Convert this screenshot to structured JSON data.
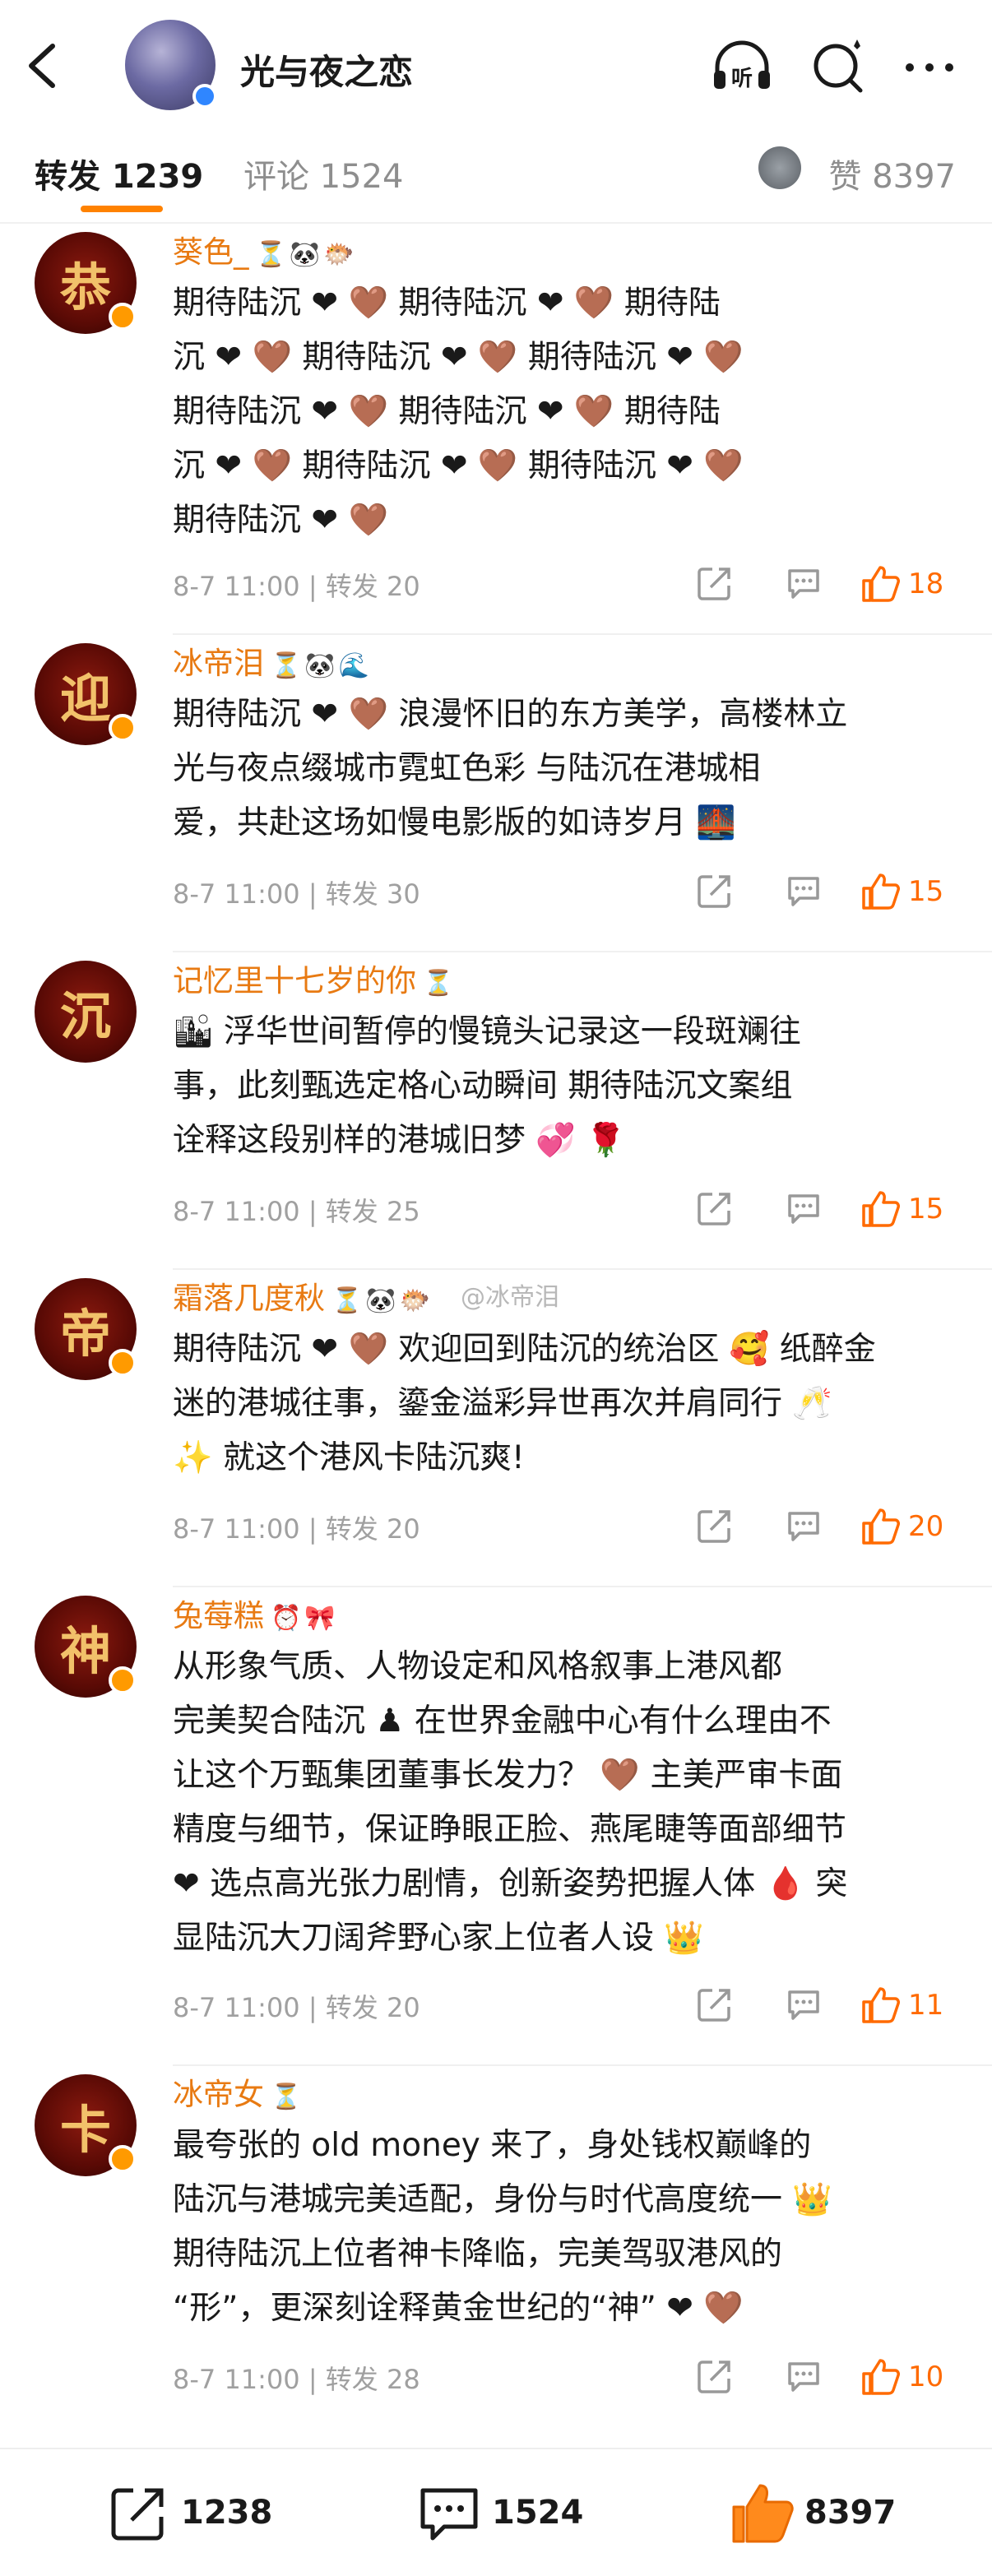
{
  "header": {
    "title": "光与夜之恋",
    "back_icon": "chevron-left-icon",
    "listen_label": "听",
    "colors": {
      "accent": "#ff8200",
      "name": "#e87a12",
      "like": "#ff6a00",
      "verified": "#2f86ff"
    }
  },
  "tabs": {
    "repost": "转发 1239",
    "comment": "评论 1524",
    "like": "赞 8397"
  },
  "watermark": "@冰帝泪",
  "comments": [
    {
      "avatar_glyph": "恭",
      "name": "葵色_",
      "name_emojis": "⏳🐼🐡",
      "lines": [
        "期待陆沉 ❤ 🤎  期待陆沉 ❤ 🤎  期待陆",
        "沉 ❤ 🤎  期待陆沉 ❤ 🤎  期待陆沉 ❤ 🤎",
        "期待陆沉 ❤ 🤎  期待陆沉 ❤ 🤎  期待陆",
        "沉 ❤ 🤎  期待陆沉 ❤ 🤎  期待陆沉 ❤ 🤎",
        "期待陆沉 ❤ 🤎"
      ],
      "meta": "8-7 11:00 | 转发 20",
      "likes": "18"
    },
    {
      "avatar_glyph": "迎",
      "name": "冰帝泪",
      "name_emojis": "⏳🐼🌊",
      "lines": [
        "期待陆沉 ❤ 🤎 浪漫怀旧的东方美学，高楼林立",
        "光与夜点缀城市霓虹色彩 与陆沉在港城相",
        "爱，共赴这场如慢电影版的如诗岁月 🌉"
      ],
      "meta": "8-7 11:00 | 转发 30",
      "likes": "15"
    },
    {
      "avatar_glyph": "沉",
      "name": "记忆里十七岁的你",
      "name_emojis": "⏳",
      "lines": [
        "🏙 浮华世间暂停的慢镜头记录这一段斑斓往",
        "事，此刻甄选定格心动瞬间 期待陆沉文案组",
        "诠释这段别样的港城旧梦 💞 🌹"
      ],
      "meta": "8-7 11:00 | 转发 25",
      "likes": "15"
    },
    {
      "avatar_glyph": "帝",
      "name": "霜落几度秋",
      "name_emojis": "⏳🐼🐡",
      "lines": [
        "期待陆沉 ❤ 🤎 欢迎回到陆沉的统治区 🥰 纸醉金",
        "迷的港城往事，鎏金溢彩异世再次并肩同行 🥂",
        "✨ 就这个港风卡陆沉爽!"
      ],
      "meta": "8-7 11:00 | 转发 20",
      "likes": "20"
    },
    {
      "avatar_glyph": "神",
      "name": "兔莓糕",
      "name_emojis": "⏰🎀",
      "lines": [
        "从形象气质、人物设定和风格叙事上港风都",
        "完美契合陆沉 ♟ 在世界金融中心有什么理由不",
        "让这个万甄集团董事长发力？ 🤎 主美严审卡面",
        "精度与细节，保证睁眼正脸、燕尾睫等面部细节",
        "❤ 选点高光张力剧情，创新姿势把握人体 🩸 突",
        "显陆沉大刀阔斧野心家上位者人设 👑"
      ],
      "meta": "8-7 11:00 | 转发 20",
      "likes": "11"
    },
    {
      "avatar_glyph": "卡",
      "name": "冰帝女",
      "name_emojis": "⏳",
      "lines": [
        "最夸张的 old money 来了，身处钱权巅峰的",
        "陆沉与港城完美适配，身份与时代高度统一 👑",
        "期待陆沉上位者神卡降临，完美驾驭港风的",
        "“形”，更深刻诠释黄金世纪的“神” ❤ 🤎"
      ],
      "meta": "8-7 11:00 | 转发 28",
      "likes": "10"
    }
  ],
  "bottom": {
    "repost": "1238",
    "comment": "1524",
    "like": "8397"
  }
}
